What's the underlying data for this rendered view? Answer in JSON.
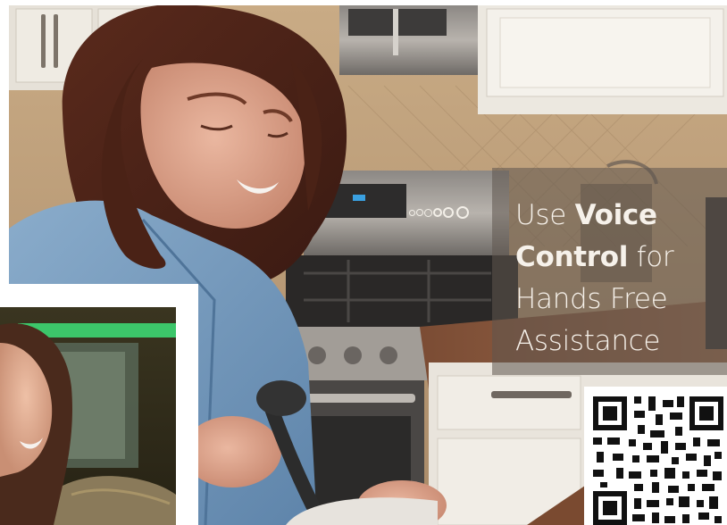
{
  "overlay": {
    "line1_regular": "Use ",
    "line1_bold": "Voice",
    "line2_bold": "Control",
    "line2_regular": " for",
    "line3": "Hands Free",
    "line4": "Assistance"
  },
  "colors": {
    "overlay_text": "#f6f1ea",
    "overlay_box": "#5f554e",
    "cabinet_white": "#ece8e0",
    "shirt_blue": "#6d93b8",
    "granite": "#8a5a3e",
    "green_light": "#3cc66a"
  },
  "icons": [
    "progress-dots-icon",
    "qr-code-icon"
  ]
}
